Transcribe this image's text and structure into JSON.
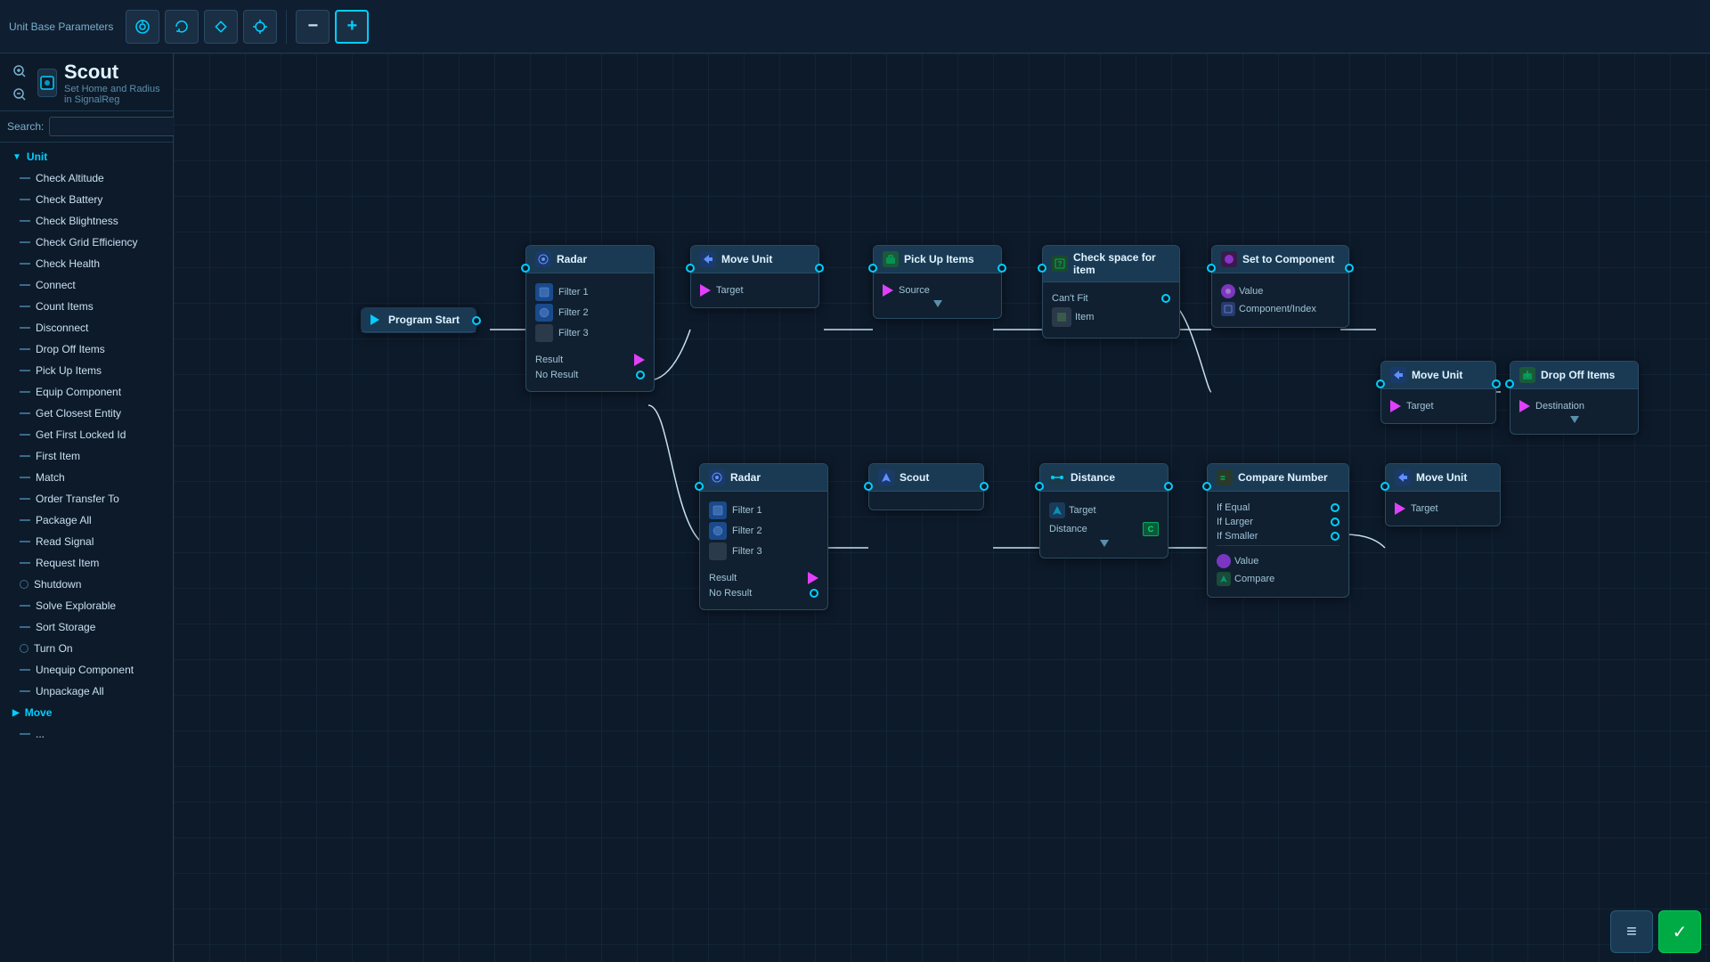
{
  "toolbar": {
    "label": "Unit Base Parameters",
    "icons": [
      "radar-icon",
      "rotate-icon",
      "diamond-icon",
      "crosshair-icon"
    ],
    "minus_label": "−",
    "plus_label": "+"
  },
  "unit": {
    "title": "Scout",
    "subtitle": "Set Home and Radius in SignalReg",
    "icon": "■"
  },
  "search": {
    "label": "Search:",
    "placeholder": ""
  },
  "sidebar": {
    "unit_section": "Unit",
    "items": [
      "Check Altitude",
      "Check Battery",
      "Check Blightness",
      "Check Grid Efficiency",
      "Check Health",
      "Connect",
      "Count Items",
      "Disconnect",
      "Drop Off Items",
      "Pick Up Items",
      "Equip Component",
      "Get Closest Entity",
      "Get First Locked Id",
      "First Item",
      "Match",
      "Order Transfer To",
      "Package All",
      "Read Signal",
      "Request Item",
      "Shutdown",
      "Solve Explorable",
      "Sort Storage",
      "Turn On",
      "Unequip Component",
      "Unpackage All"
    ],
    "move_section": "Move",
    "bottom_item": "..."
  },
  "nodes": {
    "program_start": {
      "label": "Program Start"
    },
    "radar1": {
      "label": "Radar",
      "filters": [
        "Filter 1",
        "Filter 2",
        "Filter 3"
      ],
      "result": "Result",
      "no_result": "No Result"
    },
    "move_unit1": {
      "label": "Move Unit",
      "target": "Target"
    },
    "pick_up_items": {
      "label": "Pick Up Items",
      "source": "Source"
    },
    "check_space": {
      "label": "Check space for item",
      "cant_fit": "Can't Fit",
      "item": "Item"
    },
    "set_to_component": {
      "label": "Set to Component",
      "value": "Value",
      "component_index": "Component/Index"
    },
    "move_unit2": {
      "label": "Move Unit",
      "target": "Target"
    },
    "drop_off_items": {
      "label": "Drop Off Items",
      "destination": "Destination"
    },
    "radar2": {
      "label": "Radar",
      "filters": [
        "Filter 1",
        "Filter 2",
        "Filter 3"
      ],
      "result": "Result",
      "no_result": "No Result"
    },
    "scout": {
      "label": "Scout"
    },
    "distance": {
      "label": "Distance",
      "target": "Target",
      "distance": "Distance"
    },
    "compare_number": {
      "label": "Compare Number",
      "if_equal": "If Equal",
      "if_larger": "If Larger",
      "if_smaller": "If Smaller",
      "value": "Value",
      "compare": "Compare"
    },
    "move_unit3": {
      "label": "Move Unit",
      "target": "Target"
    }
  },
  "bottom_buttons": {
    "menu_icon": "≡",
    "confirm_icon": "✓"
  }
}
